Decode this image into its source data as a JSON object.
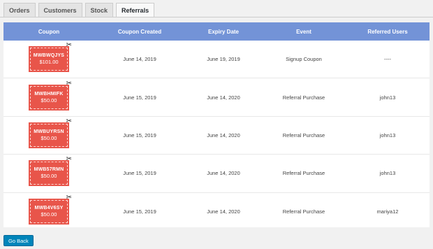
{
  "tabs": [
    "Orders",
    "Customers",
    "Stock",
    "Referrals"
  ],
  "table": {
    "headers": [
      "Coupon",
      "Coupon Created",
      "Expiry Date",
      "Event",
      "Referred Users"
    ],
    "rows": [
      {
        "code": "MWBWQJYS",
        "amount": "$101.00",
        "created": "June 14, 2019",
        "expiry": "June 19, 2019",
        "event": "Signup Coupon",
        "user": "----"
      },
      {
        "code": "MWBHMIFK",
        "amount": "$50.00",
        "created": "June 15, 2019",
        "expiry": "June 14, 2020",
        "event": "Referral Purchase",
        "user": "john13"
      },
      {
        "code": "MWBUYRSN",
        "amount": "$50.00",
        "created": "June 15, 2019",
        "expiry": "June 14, 2020",
        "event": "Referral Purchase",
        "user": "john13"
      },
      {
        "code": "MWB57RMN",
        "amount": "$50.00",
        "created": "June 15, 2019",
        "expiry": "June 14, 2020",
        "event": "Referral Purchase",
        "user": "john13"
      },
      {
        "code": "MWB4V6SY",
        "amount": "$50.00",
        "created": "June 15, 2019",
        "expiry": "June 14, 2020",
        "event": "Referral Purchase",
        "user": "mariya12"
      }
    ]
  },
  "go_back_label": "Go Back",
  "colors": {
    "header_bg": "#7393d7",
    "coupon_bg": "#e8554a",
    "button_bg": "#0085ba"
  },
  "icons": {
    "coupon_corner": "scissors-icon"
  }
}
